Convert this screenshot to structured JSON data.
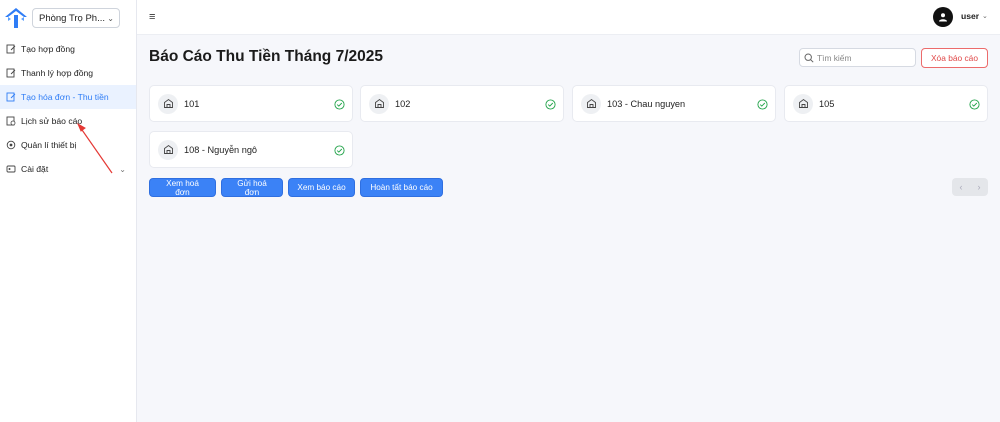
{
  "sidebar": {
    "branch_select": "Phòng Trọ Ph...",
    "items": [
      {
        "label": "Tạo hợp đồng"
      },
      {
        "label": "Thanh lý hợp đồng"
      },
      {
        "label": "Tạo hóa đơn - Thu tiền"
      },
      {
        "label": "Lịch sử báo cáo"
      },
      {
        "label": "Quản lí thiết bị"
      },
      {
        "label": "Cài đặt"
      }
    ]
  },
  "header": {
    "username": "user"
  },
  "main": {
    "title": "Báo Cáo Thu Tiền Tháng 7/2025",
    "search_placeholder": "Tìm kiếm",
    "delete_report_label": "Xóa báo cáo",
    "rooms": [
      {
        "name": "101"
      },
      {
        "name": "102"
      },
      {
        "name": "103 - Chau nguyen"
      },
      {
        "name": "105"
      },
      {
        "name": "108 - Nguyễn ngô"
      }
    ],
    "actions": {
      "view_invoice": "Xem hoá đơn",
      "send_invoice": "Gửi hoá đơn",
      "view_report": "Xem báo cáo",
      "complete_report": "Hoàn tất báo cáo"
    },
    "pager": {
      "prev": "‹",
      "next": "›"
    }
  },
  "colors": {
    "accent": "#3b82f6",
    "danger": "#e04848",
    "success": "#22a34a",
    "annotation": "#e53935"
  }
}
